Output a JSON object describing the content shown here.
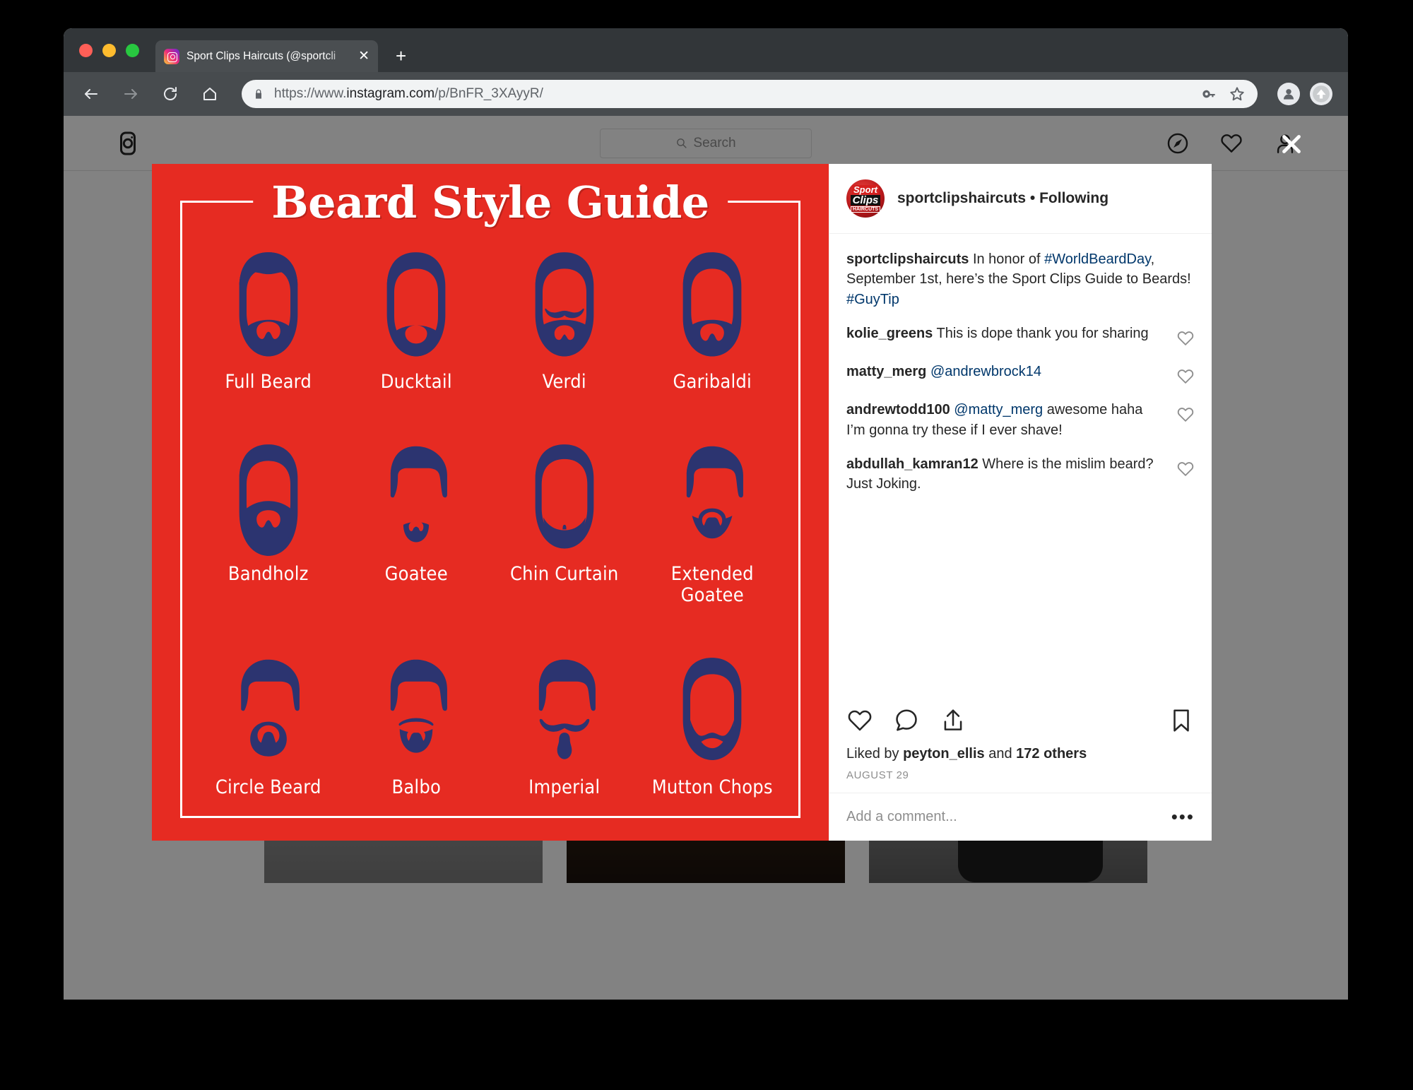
{
  "browser": {
    "tab": {
      "title": "Sport Clips Haircuts (@sportcli",
      "favicon_icon": "instagram-icon",
      "close_label": "✕"
    },
    "new_tab_label": "+",
    "toolbar": {
      "back_icon": "arrow-back-icon",
      "forward_icon": "arrow-forward-icon",
      "reload_icon": "reload-icon",
      "home_icon": "home-icon",
      "lock_icon": "lock-icon",
      "url_scheme": "https://www.",
      "url_domain": "instagram.com",
      "url_path": "/p/BnFR_3XAyyR/",
      "key_icon": "key-icon",
      "bookmark_icon": "star-icon",
      "profile_icon": "account-avatar-icon",
      "update_icon": "update-arrow-icon"
    }
  },
  "instagram_nav": {
    "logo_icon": "instagram-glyph-icon",
    "search_placeholder": "Search",
    "search_icon": "search-icon",
    "explore_icon": "compass-icon",
    "activity_icon": "heart-icon",
    "profile_icon": "person-icon"
  },
  "overlay": {
    "close_icon": "close-x-icon",
    "close_label": "✕"
  },
  "post": {
    "header": {
      "avatar_icon": "sport-clips-avatar",
      "avatar_line1": "Sport",
      "avatar_line2": "Clips",
      "avatar_line3": "HAIRCUTS",
      "username": "sportclipshaircuts",
      "separator": " • ",
      "follow_state": "Following"
    },
    "caption": {
      "username": "sportclipshaircuts",
      "text_1": " In honor of ",
      "hashtag_1": "#WorldBeardDay",
      "text_2": ", September 1st, here’s the Sport Clips Guide to Beards! ",
      "hashtag_2": "#GuyTip"
    },
    "comments": [
      {
        "username": "kolie_greens",
        "text": " This is dope thank you for sharing",
        "mention": "",
        "heart_icon": "heart-icon"
      },
      {
        "username": "matty_merg",
        "mention": "@andrewbrock14",
        "text": "",
        "heart_icon": "heart-icon"
      },
      {
        "username": "andrewtodd100",
        "mention": "@matty_merg",
        "text": " awesome haha I’m gonna try these if I ever shave!",
        "heart_icon": "heart-icon"
      },
      {
        "username": "abdullah_kamran12",
        "mention": "",
        "text": " Where is the mislim beard? Just Joking.",
        "heart_icon": "heart-icon"
      }
    ],
    "actions": {
      "like_icon": "heart-icon",
      "comment_icon": "comment-bubble-icon",
      "share_icon": "share-upload-icon",
      "save_icon": "bookmark-icon"
    },
    "likes_prefix": "Liked by ",
    "likes_user": "peyton_ellis",
    "likes_middle": " and ",
    "likes_count": "172 others",
    "timestamp": "AUGUST 29",
    "add_comment_placeholder": "Add a comment...",
    "more_options_label": "•••"
  },
  "beard_guide": {
    "title": "Beard Style Guide",
    "background_color": "#e62b22",
    "figure_color": "#2c3470",
    "text_color": "#ffffff",
    "rows": [
      [
        {
          "label": "Full Beard",
          "art": "full-beard"
        },
        {
          "label": "Ducktail",
          "art": "ducktail"
        },
        {
          "label": "Verdi",
          "art": "verdi"
        },
        {
          "label": "Garibaldi",
          "art": "garibaldi"
        }
      ],
      [
        {
          "label": "Bandholz",
          "art": "bandholz"
        },
        {
          "label": "Goatee",
          "art": "goatee"
        },
        {
          "label": "Chin Curtain",
          "art": "chin-curtain"
        },
        {
          "label": "Extended\nGoatee",
          "art": "extended-goatee"
        }
      ],
      [
        {
          "label": "Circle Beard",
          "art": "circle-beard"
        },
        {
          "label": "Balbo",
          "art": "balbo"
        },
        {
          "label": "Imperial",
          "art": "imperial"
        },
        {
          "label": "Mutton Chops",
          "art": "mutton-chops"
        }
      ]
    ]
  }
}
